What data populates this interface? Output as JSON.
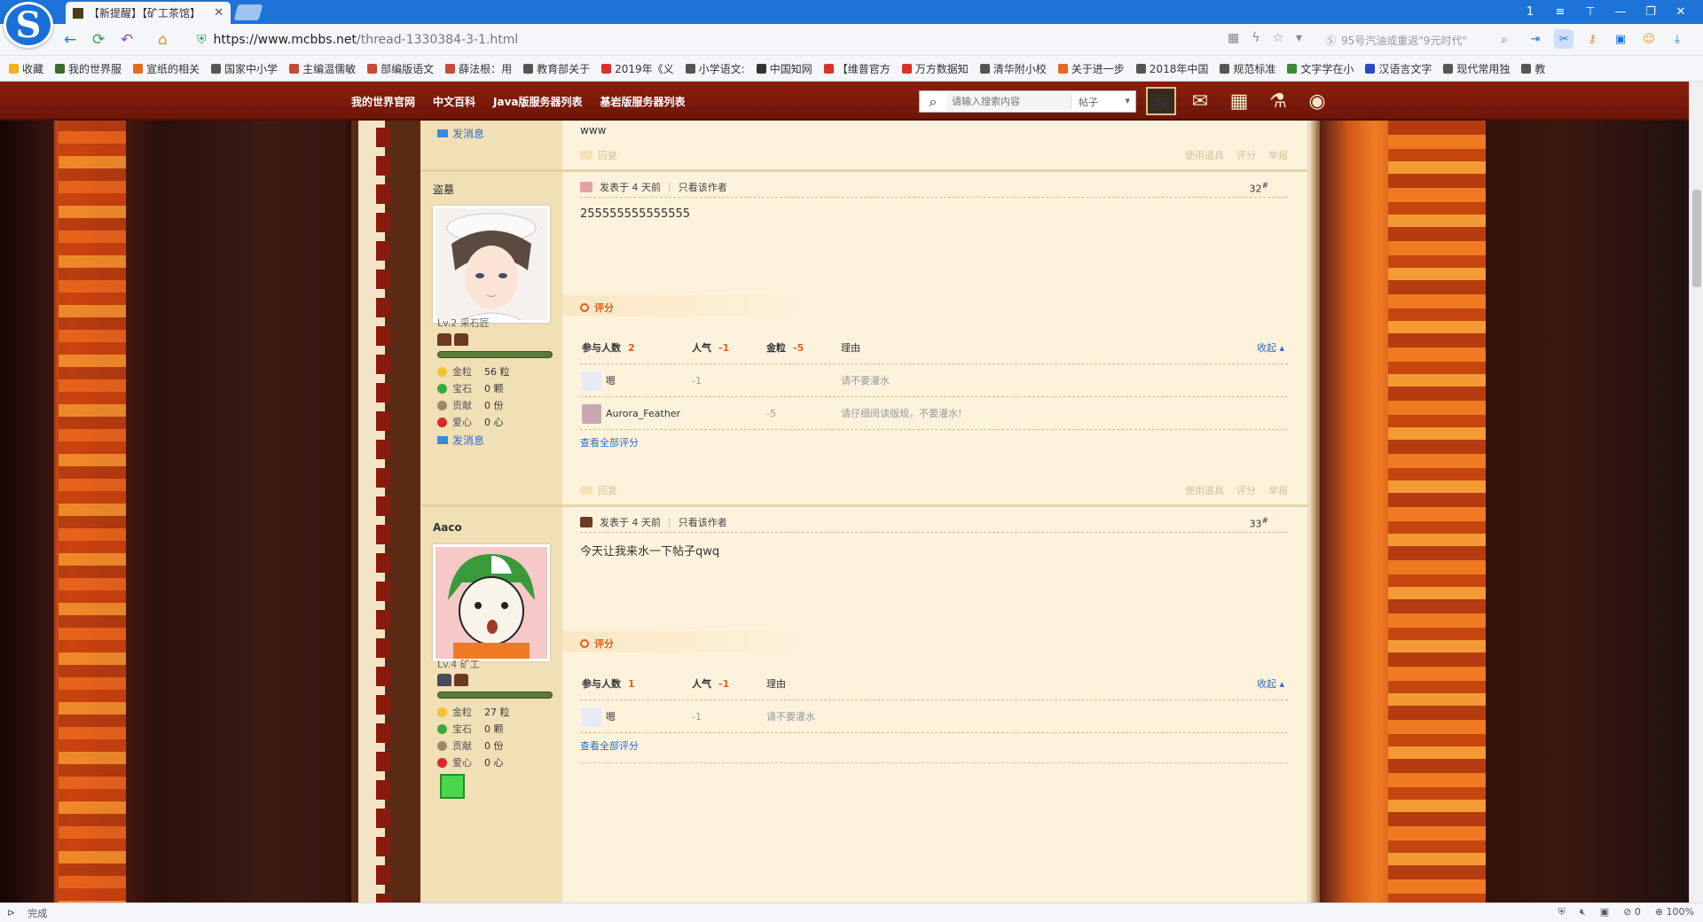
{
  "browser": {
    "tab_title": "【新提醒】【矿工茶馆】",
    "tab_close": "✕",
    "url_host": "https://www.mcbbs.net",
    "url_path": "/thread-1330384-3-1.html",
    "search_placeholder": "95号汽油或重返\"9元时代\"",
    "win_controls": [
      "1",
      "≡",
      "⊤",
      "—",
      "❐",
      "✕"
    ],
    "status": "完成",
    "status_right": [
      "0",
      "100%"
    ]
  },
  "bookmarks": [
    {
      "label": "收藏",
      "color": "#f2b01e"
    },
    {
      "label": "我的世界服",
      "color": "#3d6b2a"
    },
    {
      "label": "宣纸的相关",
      "color": "#e36b1e"
    },
    {
      "label": "国家中小学",
      "color": "#555555"
    },
    {
      "label": "主编温儒敏",
      "color": "#c84a3a"
    },
    {
      "label": "部编版语文",
      "color": "#c84a3a"
    },
    {
      "label": "薛法根：用",
      "color": "#c84a3a"
    },
    {
      "label": "教育部关于",
      "color": "#555555"
    },
    {
      "label": "2019年《义",
      "color": "#d8302a"
    },
    {
      "label": "小学语文:",
      "color": "#555555"
    },
    {
      "label": "中国知网",
      "color": "#333333"
    },
    {
      "label": "【维普官方",
      "color": "#d8302a"
    },
    {
      "label": "万方数据知",
      "color": "#d8302a"
    },
    {
      "label": "清华附小校",
      "color": "#555555"
    },
    {
      "label": "关于进一步",
      "color": "#e36b1e"
    },
    {
      "label": "2018年中国",
      "color": "#555555"
    },
    {
      "label": "规范标准",
      "color": "#555555"
    },
    {
      "label": "文字学在小",
      "color": "#3a8a3a"
    },
    {
      "label": "汉语言文字",
      "color": "#2a4ac6"
    },
    {
      "label": "现代常用独",
      "color": "#555555"
    },
    {
      "label": "教",
      "color": "#555555"
    }
  ],
  "site": {
    "nav_links": [
      "我的世界官网",
      "中文百科",
      "Java版服务器列表",
      "基岩版服务器列表"
    ],
    "search_placeholder": "请输入搜索内容",
    "search_scope": "帖子",
    "search_scope_arrow": "▾"
  },
  "labels": {
    "send_message": "发消息",
    "posted_prefix": "发表于",
    "only_author": "只看该作者",
    "rate_title": "评分",
    "participants": "参与人数",
    "popularity": "人气",
    "gold": "金粒",
    "reason": "理由",
    "collapse": "收起",
    "see_all": "查看全部评分",
    "reply": "回复",
    "use_tool": "使用道具",
    "rate": "评分",
    "report": "举报",
    "stat_gold": "金粒",
    "stat_gem": "宝石",
    "stat_contrib": "贡献",
    "stat_love": "爱心"
  },
  "prev_post": {
    "content": "www"
  },
  "posts": [
    {
      "author": "盗墓",
      "level": "Lv.2 采石匠",
      "stats": {
        "gold": "56 粒",
        "gem": "0 颗",
        "contrib": "0 份",
        "love": "0 心"
      },
      "time": "4 天前",
      "floor": "32",
      "content": "255555555555555",
      "participants_count": "2",
      "popularity_total": "-1",
      "gold_total": "-5",
      "ratings": [
        {
          "user": "嗯",
          "pop": "-1",
          "gold": "",
          "reason": "请不要灌水"
        },
        {
          "user": "Aurora_Feather",
          "pop": "",
          "gold": "-5",
          "reason": "请仔细阅读版规，不要灌水!"
        }
      ]
    },
    {
      "author": "Aaco",
      "level": "Lv.4 矿工",
      "stats": {
        "gold": "27 粒",
        "gem": "0 颗",
        "contrib": "0 份",
        "love": "0 心"
      },
      "time": "4 天前",
      "floor": "33",
      "content": "今天让我来水一下帖子qwq",
      "participants_count": "1",
      "popularity_total": "-1",
      "ratings": [
        {
          "user": "嗯",
          "pop": "-1",
          "reason": "请不要灌水"
        }
      ]
    }
  ]
}
